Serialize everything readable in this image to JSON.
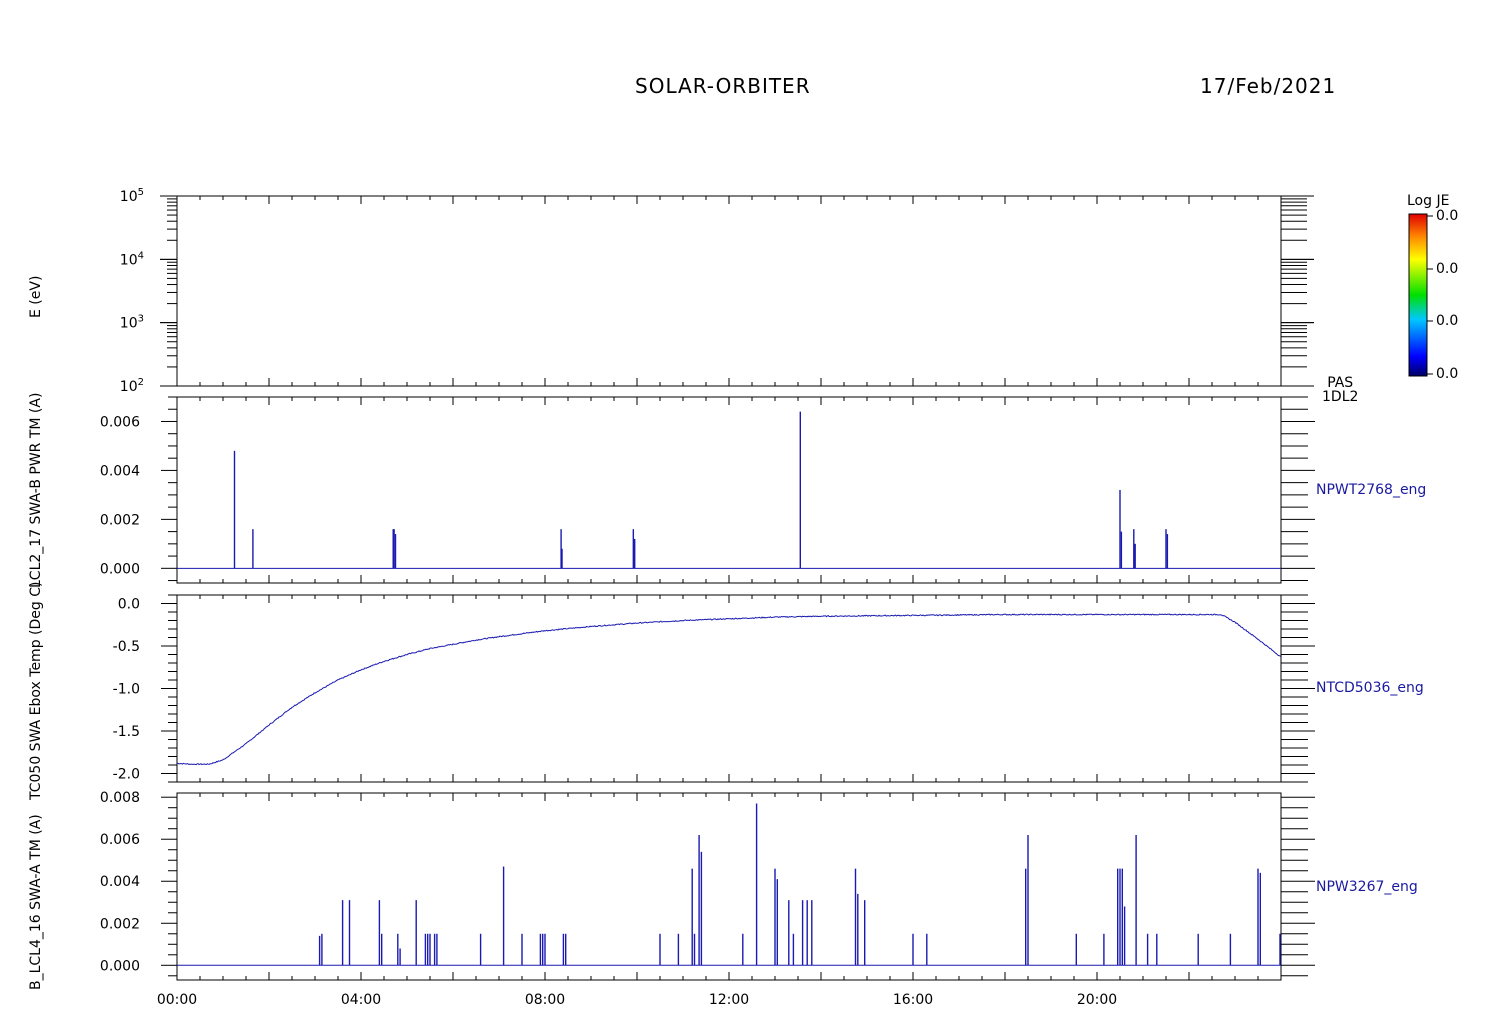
{
  "header": {
    "mission": "SOLAR-ORBITER",
    "date": "17/Feb/2021"
  },
  "colorbar": {
    "title": "Log JE",
    "tick_labels": [
      "0.0",
      "0.0",
      "0.0",
      "0.0"
    ]
  },
  "instrument_label": {
    "line1": "PAS",
    "line2": "1DL2"
  },
  "chart_data": [
    {
      "type": "heatmap",
      "ylabel": "E (eV)",
      "y_scale": "log",
      "ylim": [
        100,
        100000
      ],
      "y_tick_labels": [
        "10^2",
        "10^3",
        "10^4",
        "10^5"
      ],
      "values": []
    },
    {
      "type": "bar",
      "ylabel": "LCL2_17 SWA-B PWR TM (A)",
      "side_label": "NPWT2768_eng",
      "ylim": [
        -0.0006,
        0.007
      ],
      "y_tick_labels": [
        "0.000",
        "0.002",
        "0.004",
        "0.006"
      ],
      "x_unit": "hours",
      "x": [
        1.25,
        1.65,
        4.7,
        4.72,
        4.75,
        8.35,
        8.37,
        9.92,
        9.95,
        13.55,
        20.5,
        20.53,
        20.8,
        20.83,
        21.5,
        21.53
      ],
      "values": [
        0.0048,
        0.0016,
        0.0016,
        0.0016,
        0.0014,
        0.0016,
        0.0008,
        0.0016,
        0.0012,
        0.0064,
        0.0032,
        0.0015,
        0.0016,
        0.001,
        0.0016,
        0.0014
      ]
    },
    {
      "type": "line",
      "ylabel": "TC050 SWA Ebox Temp (Deg C)",
      "side_label": "NTCD5036_eng",
      "ylim": [
        -2.1,
        0.1
      ],
      "y_tick_labels": [
        "-2.0",
        "-1.5",
        "-1.0",
        "-0.5",
        "0.0"
      ],
      "x_unit": "hours",
      "x": [
        0,
        0.3,
        0.7,
        1.0,
        1.5,
        2.0,
        2.5,
        3.0,
        3.5,
        4.0,
        4.5,
        5.0,
        5.5,
        6.0,
        6.5,
        7.0,
        8.0,
        9.0,
        10.0,
        11.0,
        12.0,
        13.0,
        14.0,
        16.0,
        18.0,
        20.0,
        22.0,
        22.7,
        23.0,
        23.5,
        24.0
      ],
      "values": [
        -1.88,
        -1.89,
        -1.89,
        -1.84,
        -1.65,
        -1.43,
        -1.22,
        -1.05,
        -0.9,
        -0.78,
        -0.68,
        -0.6,
        -0.53,
        -0.48,
        -0.43,
        -0.39,
        -0.32,
        -0.27,
        -0.23,
        -0.2,
        -0.18,
        -0.16,
        -0.15,
        -0.14,
        -0.13,
        -0.13,
        -0.13,
        -0.13,
        -0.22,
        -0.42,
        -0.63
      ]
    },
    {
      "type": "bar",
      "ylabel": "B_LCL4_16 SWA-A TM (A)",
      "side_label": "NPW3267_eng",
      "ylim": [
        -0.0007,
        0.0082
      ],
      "y_tick_labels": [
        "0.000",
        "0.002",
        "0.004",
        "0.006",
        "0.008"
      ],
      "x_label": "",
      "x_tick_labels": [
        "00:00",
        "04:00",
        "08:00",
        "12:00",
        "16:00",
        "20:00"
      ],
      "x_unit": "hours",
      "xlim": [
        0,
        24
      ],
      "x": [
        3.1,
        3.15,
        3.6,
        3.75,
        4.4,
        4.45,
        4.8,
        4.85,
        5.2,
        5.4,
        5.45,
        5.5,
        5.6,
        5.65,
        6.6,
        7.1,
        7.5,
        7.9,
        7.95,
        8.0,
        8.4,
        8.45,
        10.5,
        10.9,
        11.2,
        11.25,
        11.35,
        11.4,
        12.3,
        12.6,
        13.0,
        13.05,
        13.3,
        13.4,
        13.6,
        13.7,
        13.8,
        14.75,
        14.8,
        14.95,
        16.0,
        16.3,
        18.45,
        18.5,
        19.55,
        20.15,
        20.45,
        20.5,
        20.55,
        20.6,
        20.85,
        21.1,
        21.3,
        22.2,
        22.9,
        23.5,
        23.55,
        24.0
      ],
      "values": [
        0.0014,
        0.0015,
        0.0031,
        0.0031,
        0.0031,
        0.0015,
        0.0015,
        0.0008,
        0.0031,
        0.0015,
        0.0015,
        0.0015,
        0.0015,
        0.0015,
        0.0015,
        0.0047,
        0.0015,
        0.0015,
        0.0015,
        0.0015,
        0.0015,
        0.0015,
        0.0015,
        0.0015,
        0.0046,
        0.0015,
        0.0062,
        0.0054,
        0.0015,
        0.0077,
        0.0046,
        0.0041,
        0.0031,
        0.0015,
        0.0031,
        0.0031,
        0.0031,
        0.0046,
        0.0034,
        0.0031,
        0.0015,
        0.0015,
        0.0046,
        0.0062,
        0.0015,
        0.0015,
        0.0046,
        0.0046,
        0.0046,
        0.0028,
        0.0062,
        0.0015,
        0.0015,
        0.0015,
        0.0015,
        0.0046,
        0.0044,
        0.0015
      ]
    }
  ]
}
